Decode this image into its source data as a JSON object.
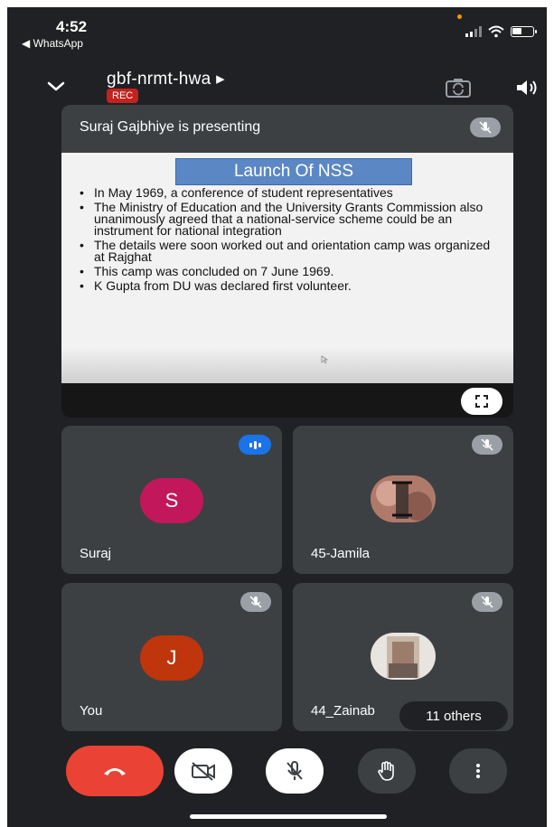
{
  "status_bar": {
    "time": "4:52",
    "back_app": "◀ WhatsApp"
  },
  "header": {
    "meeting_code": "gbf-nrmt-hwa ▸",
    "rec_label": "REC"
  },
  "presentation": {
    "title": "Suraj Gajbhiye is presenting",
    "slide": {
      "heading": "Launch Of NSS",
      "bullets": [
        "In May 1969, a conference of student representatives",
        "The Ministry of Education and the University Grants Commission also unanimously agreed that a national-service scheme could be an instrument for national integration",
        "The details were soon worked out and orientation camp was organized at Rajghat",
        "This camp was concluded on 7 June 1969.",
        "K Gupta from DU was declared first volunteer."
      ]
    }
  },
  "participants": [
    {
      "name": "Suraj",
      "initial": "S",
      "avatar_color": "#c2185b",
      "status": "speaking"
    },
    {
      "name": "45-Jamila",
      "status": "muted"
    },
    {
      "name": "You",
      "initial": "J",
      "avatar_color": "#bf360c",
      "status": "muted"
    },
    {
      "name": "44_Zainab",
      "status": "muted"
    }
  ],
  "others_label": "11 others",
  "controls": {
    "end_call_icon": "phone-hangup-icon",
    "camera_icon": "video-off-icon",
    "mic_icon": "mic-off-icon",
    "hand_icon": "raise-hand-icon",
    "more_icon": "more-vert-icon"
  },
  "colors": {
    "background": "#202124",
    "tile": "#3c4043",
    "end_call": "#ea4335",
    "rec": "#c5221f",
    "speaking": "#1a73e8"
  }
}
